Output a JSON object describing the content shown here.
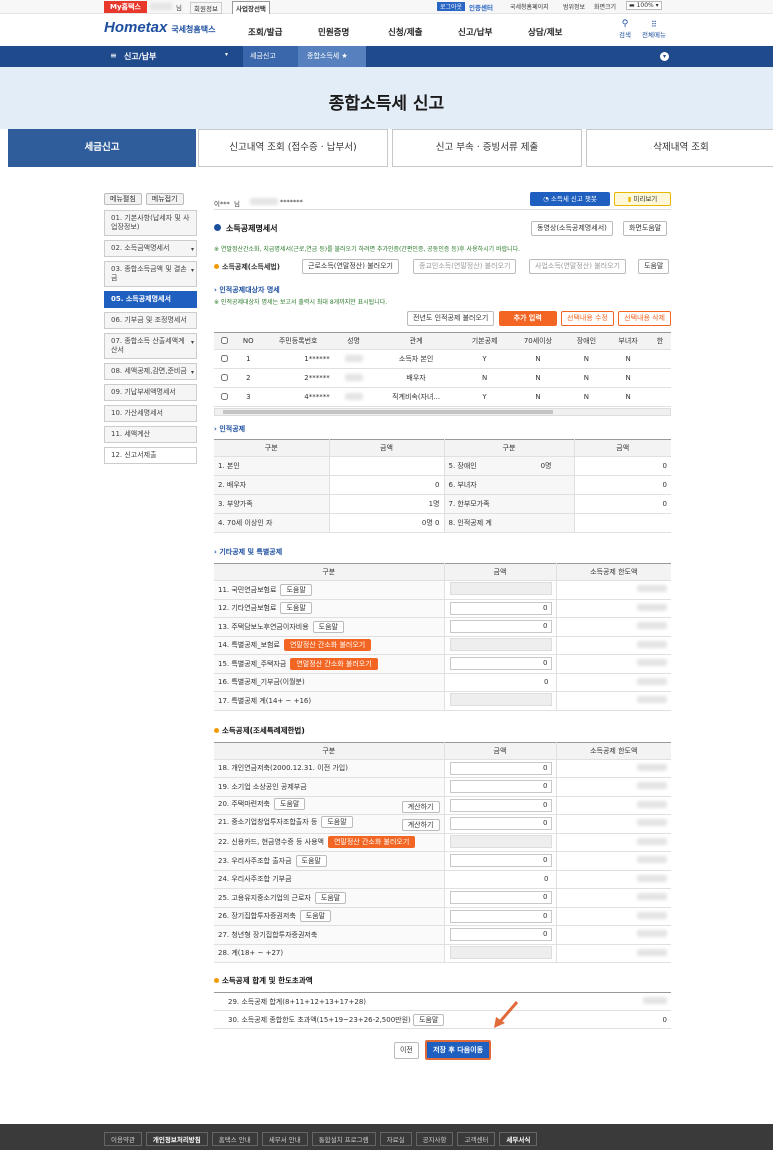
{
  "topbar": {
    "my": "My홈택스",
    "user_suffix": "님",
    "member_info": "회원정보",
    "biz_select": "사업장선택",
    "logout": "로그아웃",
    "cert": "인증센터",
    "home": "국세청홈페이지",
    "map": "범위정보",
    "screen": "화면크기",
    "zoom": "100%"
  },
  "brand": {
    "logo": "Hometax",
    "sub": "국세청홈택스"
  },
  "gnb": [
    "조회/발급",
    "민원증명",
    "신청/제출",
    "신고/납부",
    "상담/제보"
  ],
  "util": {
    "search": "검색",
    "all": "전체메뉴"
  },
  "crumb": {
    "menu": "신고/납부",
    "c1": "세금신고",
    "c2": "종합소득세"
  },
  "page_title": "종합소득세 신고",
  "tabs": [
    "세금신고",
    "신고내역 조회 (접수증 · 납부서)",
    "신고 부속 · 증빙서류 제출",
    "삭제내역 조회"
  ],
  "side": {
    "expand": "메뉴펼침",
    "collapse": "메뉴접기",
    "items": [
      "01. 기본사항(납세자 및 사업장정보)",
      "02. 소득금액명세서",
      "03. 종합소득금액 및 결손금",
      "05. 소득공제명세서",
      "06. 기부금 및 조정명세서",
      "07. 종합소득 산출세액계산서",
      "08. 세액공제,감면,준비금",
      "09. 기납부세액명세서",
      "10. 가산세명세서",
      "11. 세액계산",
      "12. 신고서제출"
    ]
  },
  "who": {
    "prefix": "이***",
    "suffix": "님",
    "masked": "*******"
  },
  "chatbot": "소득세 신고 챗봇",
  "preview": "미리보기",
  "form": {
    "title": "소득공제명세서",
    "video": "동영상(소득공제명세서)",
    "help": "화면도움말",
    "notice": "※ 연말정산간소화, 지급명세서(근로,연금 등)를 불러오기 하려면 추가인증(간편인증, 공동인증 등)후 사용하시기 바랍니다.",
    "ded_label": "소득공제(소득세법)",
    "load1": "근로소득(연말정산) 불러오기",
    "load2": "종교인소득(연말정산) 불러오기",
    "load3": "사업소득(연말정산) 불러오기",
    "help2": "도움말"
  },
  "personal": {
    "title": "인적공제대상자 명세",
    "notice": "※ 인적공제대상자 명세는 보고서 출력시 최대 8개까지만 표시됩니다.",
    "prev": "전년도 인적공제 불러오기",
    "add": "추가 입력",
    "edit": "선택내용 수정",
    "del": "선택내용 삭제",
    "headers": [
      "NO",
      "주민등록번호",
      "성명",
      "관계",
      "기본공제",
      "70세이상",
      "장애인",
      "부녀자",
      "한"
    ],
    "rows": [
      [
        "1",
        "1******",
        "소득자 본인",
        "Y",
        "N",
        "N",
        "N"
      ],
      [
        "2",
        "2******",
        "배우자",
        "N",
        "N",
        "N",
        "N"
      ],
      [
        "3",
        "4******",
        "직계비속(자녀...",
        "Y",
        "N",
        "N",
        "N"
      ]
    ]
  },
  "human": {
    "title": "인적공제",
    "h": [
      "구분",
      "금액",
      "구분",
      "금액"
    ],
    "rows": [
      [
        "1. 본인",
        "",
        "5. 장애인",
        "0명",
        "0"
      ],
      [
        "2. 배우자",
        "0",
        "6. 부녀자",
        "",
        "0"
      ],
      [
        "3. 부양가족",
        "1명",
        "7. 한부모가족",
        "",
        "0"
      ],
      [
        "4. 70세 이상인 자",
        "0명 0",
        "8. 인적공제 계",
        "",
        ""
      ]
    ]
  },
  "other": {
    "title": "기타공제 및 특별공제",
    "h": [
      "구분",
      "금액",
      "소득공제 한도액"
    ],
    "rows": [
      {
        "l": "11. 국민연금보험료",
        "b": "도움말",
        "v": ""
      },
      {
        "l": "12. 기타연금보험료",
        "b": "도움말",
        "v": "0"
      },
      {
        "l": "13. 주택담보노후연금이자비용",
        "b": "도움말",
        "v": "0"
      },
      {
        "l": "14. 특별공제_보험료",
        "o": "연말정산 간소화 불러오기",
        "v": ""
      },
      {
        "l": "15. 특별공제_주택자금",
        "o": "연말정산 간소화 불러오기",
        "v": "0"
      },
      {
        "l": "16. 특별공제_기부금(이월분)",
        "v": "0"
      },
      {
        "l": "17. 특별공제 계(14+ ~ +16)",
        "v": ""
      }
    ]
  },
  "tax": {
    "title": "소득공제(조세특례제한법)",
    "h": [
      "구분",
      "금액",
      "소득공제 한도액"
    ],
    "rows": [
      {
        "l": "18. 개인연금저축(2000.12.31. 이전 가입)",
        "v": "0"
      },
      {
        "l": "19. 소기업 소상공인 공제부금",
        "v": "0"
      },
      {
        "l": "20. 주택마련저축",
        "b": "도움말",
        "c": "계산하기",
        "v": "0"
      },
      {
        "l": "21. 중소기업창업투자조합출자 등",
        "b": "도움말",
        "c": "계산하기",
        "v": "0"
      },
      {
        "l": "22. 신용카드, 현금영수증 등 사용액",
        "o": "연말정산 간소화 불러오기",
        "v": ""
      },
      {
        "l": "23. 우리사주조합 출자금",
        "b": "도움말",
        "v": "0"
      },
      {
        "l": "24. 우리사주조합 기부금",
        "v": "0"
      },
      {
        "l": "25. 고용유지중소기업의 근로자",
        "b": "도움말",
        "v": "0"
      },
      {
        "l": "26. 장기집합투자증권저축",
        "b": "도움말",
        "v": "0"
      },
      {
        "l": "27. 청년형 장기집합투자증권저축",
        "v": "0"
      },
      {
        "l": "28. 계(18+ ~ +27)",
        "v": ""
      }
    ]
  },
  "total": {
    "title": "소득공제 합계 및 한도초과액",
    "r1": "29. 소득공제 합계(8+11+12+13+17+28)",
    "r2": "30. 소득공제 종합한도 초과액(15+19~23+26-2,500만원)",
    "r2b": "도움말",
    "r2v": "0"
  },
  "nav": {
    "prev": "이전",
    "next": "저장 후 다음이동"
  },
  "footer": [
    "이용약관",
    "개인정보처리방침",
    "홈택스 안내",
    "세무서 안내",
    "통합설치 프로그램",
    "자료실",
    "공지사항",
    "고객센터",
    "세무서식"
  ]
}
